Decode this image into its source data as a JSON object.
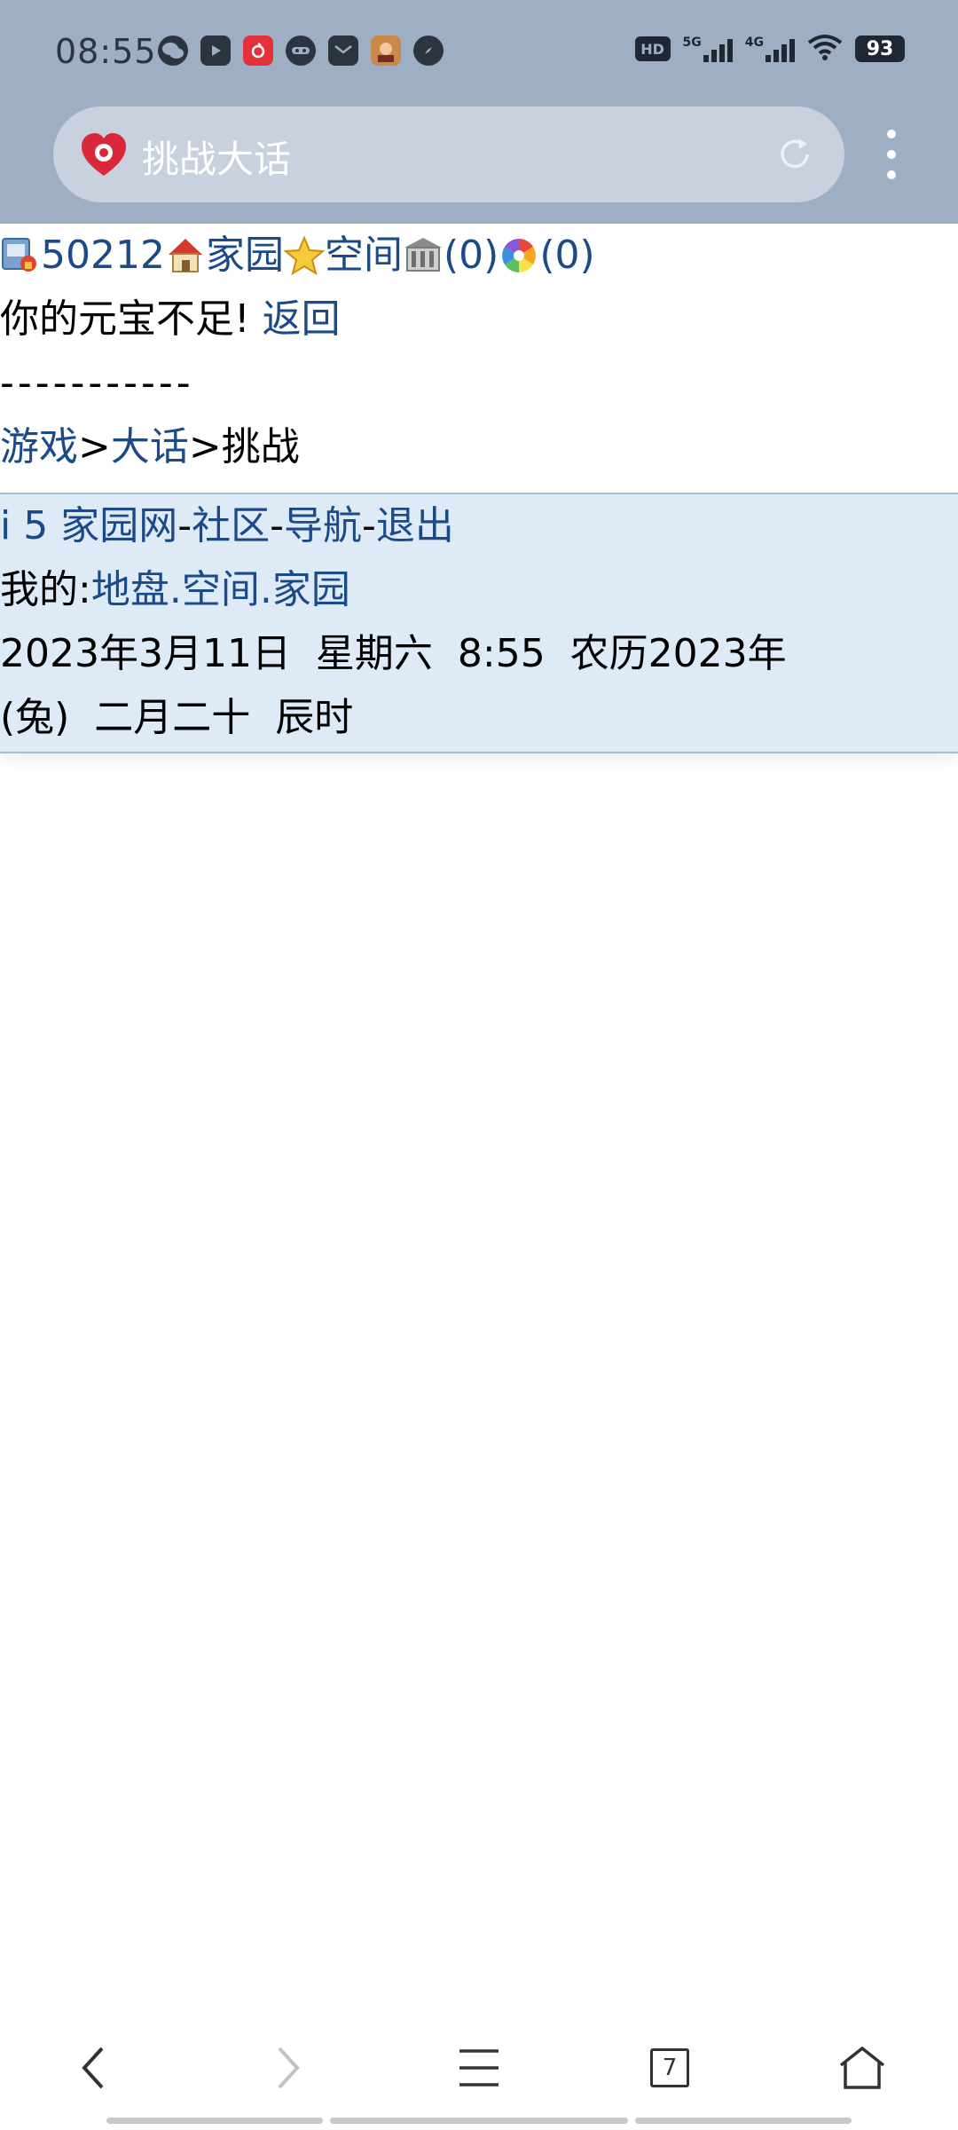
{
  "status_bar": {
    "time": "08:55",
    "battery": "93",
    "hd": "HD",
    "net1": "5G",
    "net2": "4G",
    "app_icons": [
      "wechat-icon",
      "video-icon",
      "netease-music-icon",
      "game-face-icon",
      "mailbox-icon",
      "game-avatar-icon",
      "compass-icon"
    ]
  },
  "browser": {
    "url_text": "挑战大话",
    "tab_count": "7"
  },
  "page": {
    "top_links": {
      "user_id": "50212",
      "home": "家园",
      "space": "空间",
      "count1": "(0)",
      "count2": "(0)"
    },
    "message": "你的元宝不足!",
    "back_link": "返回",
    "divider": "-----------",
    "breadcrumb": {
      "games": "游戏",
      "sep1": ">",
      "dahua": "大话",
      "sep2": ">",
      "current": "挑战"
    }
  },
  "footer": {
    "site": "i 5 家园网",
    "sep1": "-",
    "community": "社区",
    "sep2": "-",
    "nav": "导航",
    "sep3": "-",
    "logout": "退出",
    "my_label": "我的:",
    "turf": "地盘",
    "dot1": ".",
    "space": "空间",
    "dot2": ".",
    "home": "家园",
    "date_line1": "2023年3月11日  星期六  8:55  农历2023年",
    "date_line2": "(兔)  二月二十  辰时"
  }
}
